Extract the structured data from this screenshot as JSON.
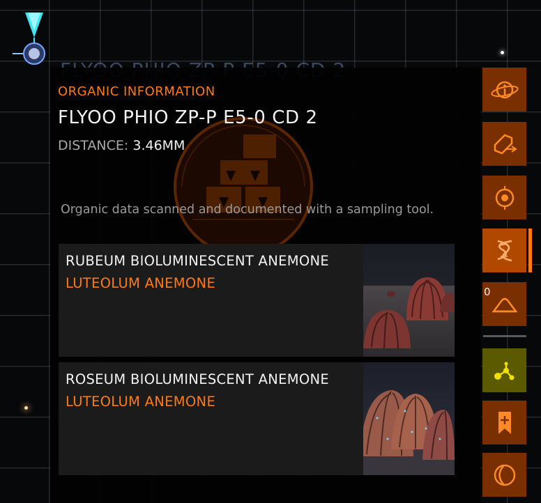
{
  "background_title": "FLYOO PHIO ZP-P E5-0 CD 2",
  "panel": {
    "header": "ORGANIC INFORMATION",
    "body_name": "FLYOO PHIO ZP-P E5-0 CD 2",
    "distance_label": "DISTANCE:",
    "distance_value": "3.46MM",
    "description": "Organic data scanned and documented with a sampling tool."
  },
  "organics": [
    {
      "species": "RUBEUM BIOLUMINESCENT ANEMONE",
      "genus": "LUTEOLUM ANEMONE"
    },
    {
      "species": "ROSEUM BIOLUMINESCENT ANEMONE",
      "genus": "LUTEOLUM ANEMONE"
    }
  ],
  "sidebar": {
    "buttons": [
      {
        "icon": "planet-info-icon"
      },
      {
        "icon": "surface-scan-icon"
      },
      {
        "icon": "orbit-target-icon"
      },
      {
        "icon": "dna-organic-icon",
        "active": true
      },
      {
        "icon": "terrain-icon",
        "count": "0"
      },
      {
        "icon": "route-plot-icon"
      },
      {
        "icon": "bookmark-icon"
      },
      {
        "icon": "moon-phase-icon"
      }
    ]
  },
  "colors": {
    "accent": "#ff7a14",
    "button_bg": "#7a2f00",
    "button_active_bg": "#b04800",
    "button_yellow_bg": "#5c5a00",
    "text": "#f2f2f2",
    "muted": "#9a9a9a",
    "card_bg": "#1b1b1c"
  }
}
